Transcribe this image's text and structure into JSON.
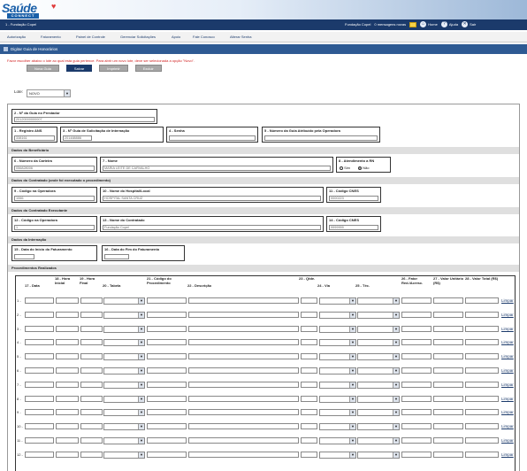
{
  "brand": {
    "logo": "Saúde",
    "logo_sub": "CONNECT"
  },
  "topbar": {
    "location": "1 - Fundação Copel",
    "org": "Fundação Copel",
    "messages": "0 mensagens novas",
    "home": "Home",
    "help": "Ajuda",
    "exit": "Sair"
  },
  "menu": [
    "Autorização",
    "Faturamento",
    "Painel de Controle",
    "Gerenciar Solicitações",
    "Apoio",
    "Fale Conosco",
    "Alterar Senha"
  ],
  "page": {
    "title": "Digitar Guia de Honorários"
  },
  "info_msg": "Favor escolher abaixo o lote ao qual esta guia pertence. Para abrir um novo lote, deve ser selecionada a opção \"Novo\".",
  "buttons": {
    "new": "Nova Guia",
    "save": "Salvar",
    "print": "Imprimir",
    "delete": "Excluir"
  },
  "lote": {
    "label": "Lote:",
    "value": "NOVO"
  },
  "fields": {
    "f2": {
      "label": "2 - Nº da Guia no Prestador",
      "value": "20120000000007"
    },
    "f1": {
      "label": "1 - Registro ANS",
      "value": "338161"
    },
    "f3": {
      "label": "3 - Nº Guia de Solicitação de Internação",
      "value": "201488886"
    },
    "f4": {
      "label": "4 - Senha",
      "value": ""
    },
    "f5": {
      "label": "5 - Número da Guia Atribuído pela Operadora",
      "value": ""
    },
    "f6": {
      "label": "6 - Número da Carteira",
      "value": "056828006"
    },
    "f7": {
      "label": "7 - Nome",
      "value": "MARIA LEITE DE CARVALHO"
    },
    "f8": {
      "label": "8 - Atendimento a RN",
      "yes": "Sim",
      "no": "Não"
    },
    "f9": {
      "label": "9 - Código na Operadora",
      "value": "1066"
    },
    "f10": {
      "label": "10 - Nome do Hospital/Local",
      "value": "HOSPITAL SANTA CRUZ"
    },
    "f11": {
      "label": "11 - Código CNES",
      "value": "0000223"
    },
    "f12": {
      "label": "12 - Código na Operadora",
      "value": "1"
    },
    "f13": {
      "label": "13 - Nome do Contratado",
      "value": "Fundação Copel"
    },
    "f14": {
      "label": "14 - Código CNES",
      "value": "9999999"
    },
    "f15": {
      "label": "15 - Data do Início do Faturamento",
      "value": ""
    },
    "f16": {
      "label": "16 - Data do Fim do Faturamento",
      "value": ""
    }
  },
  "sections": {
    "beneficiario": "Dados do Beneficiário",
    "contratado_proc": "Dados do Contratado (onde foi executado o procedimento)",
    "contratado_exec": "Dados do Contratado Executante",
    "internacao": "Dados da Internação",
    "procedimentos": "Procedimentos Realizados"
  },
  "proc_headers": [
    "17 - Data",
    "18 - Hora Inicial",
    "19 - Hora Final",
    "20 - Tabela",
    "21 - Código do Procedimento",
    "22 - Descrição",
    "23 - Qtde.",
    "24 - Via",
    "25 - Téc.",
    "26 - Fator Red./Acresc.",
    "27 - Valor Unitário (R$)",
    "28 - Valor Total (R$)"
  ],
  "rows": [
    "1",
    "2",
    "3",
    "4",
    "5",
    "6",
    "7",
    "8",
    "9",
    "10",
    "11",
    "12"
  ],
  "row_action": "Limpar"
}
